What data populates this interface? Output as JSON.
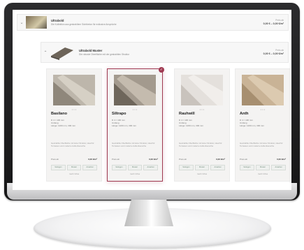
{
  "rows": [
    {
      "title": "Ultrabold",
      "subtitle": "Die Kollektion aus gestrahltem Sichtbeton für exklusive Ansprüche",
      "price_label": "Preis ab",
      "price_value": "0,00 € – 0,00 €/m²"
    },
    {
      "title": "Ultrabold Muster",
      "subtitle": "Die robuste Oberfläche mit der gestrahlten Struktur",
      "price_label": "Preis ab",
      "price_value": "0,00 € – 0,00 €/m²"
    }
  ],
  "cards": [
    {
      "name": "Basilano",
      "meta": [
        "D 4 = 100 mm",
        "Umfang",
        "Länge: 1200 mm, 300 mm"
      ],
      "desc": "Gestrahlte Oberfläche mit feiner Struktur, ideal für Terrassen und moderne Außenbereiche",
      "price_label": "Preis ab",
      "price_value": "0,00 €/m²",
      "options": [
        "Verlegen",
        "Muster",
        "Ansehen"
      ],
      "more": "mehr Infos",
      "selected": false
    },
    {
      "name": "Siltrapo",
      "meta": [
        "D 4 = 100 mm",
        "Umfang",
        "Länge: 1200 mm, 300 mm"
      ],
      "desc": "Gestrahlte Oberfläche mit feiner Struktur, ideal für Terrassen und moderne Außenbereiche",
      "price_label": "Preis ab",
      "price_value": "0,00 €/m²",
      "options": [
        "Verlegen",
        "Muster",
        "Ansehen"
      ],
      "more": "mehr Infos",
      "selected": true,
      "badge": "✓"
    },
    {
      "name": "Rauhwill",
      "meta": [
        "D 4 = 100 mm",
        "Umfang",
        "Länge: 1200 mm, 300 mm"
      ],
      "desc": "Gestrahlte Oberfläche mit feiner Struktur, ideal für Terrassen und moderne Außenbereiche",
      "price_label": "Preis ab",
      "price_value": "0,00 €/m²",
      "options": [
        "Verlegen",
        "Muster",
        "Ansehen"
      ],
      "more": "mehr Infos",
      "selected": false
    },
    {
      "name": "Anth",
      "meta": [
        "D 4 = 100 mm",
        "Umfang",
        "Länge: 1200 mm, 300 mm"
      ],
      "desc": "Gestrahlte Oberfläche mit feiner Struktur, ideal für Terrassen und moderne Außenbereiche",
      "price_label": "Preis ab",
      "price_value": "0,00 €/m²",
      "options": [
        "Verlegen",
        "Muster",
        "Ansehen"
      ],
      "more": "mehr Infos",
      "selected": false
    }
  ],
  "carousel_dots": "• • •",
  "chevron_icon": "chevron-down-icon",
  "accent_color": "#a03a52",
  "option_color": "#6f8a79"
}
